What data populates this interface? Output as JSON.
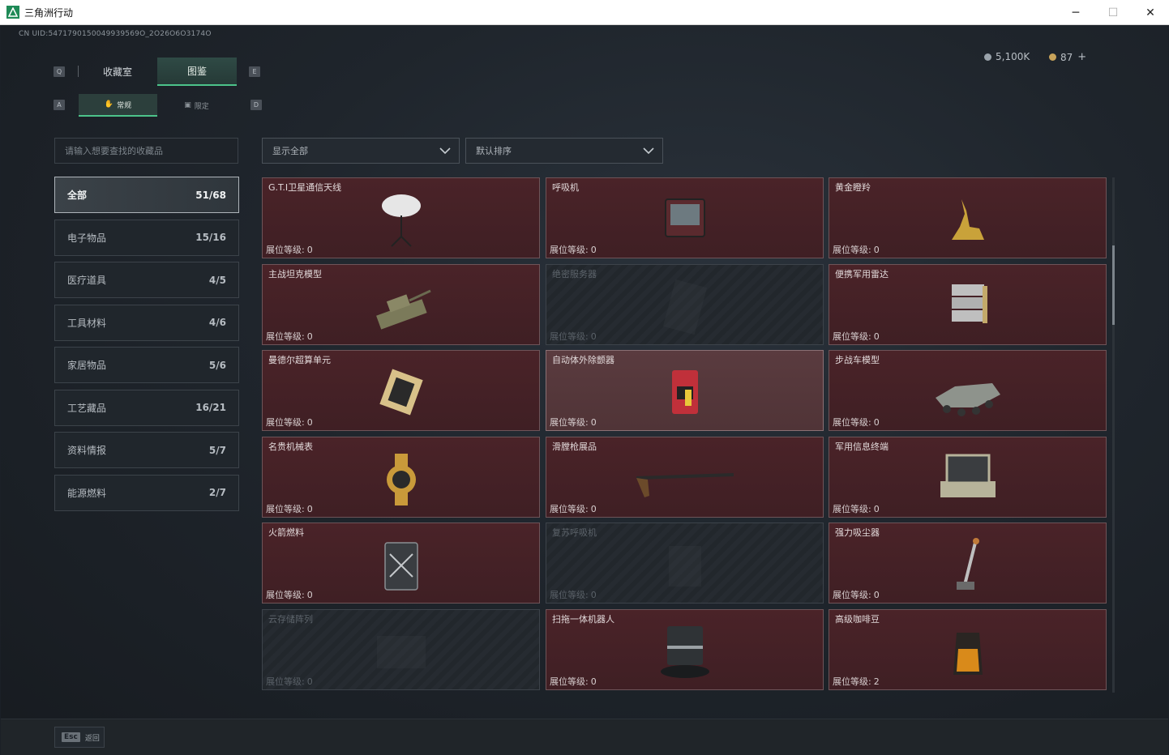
{
  "window": {
    "title": "三角洲行动",
    "minimize_icon": "minimize-icon",
    "maximize_icon": "maximize-icon",
    "close_icon": "close-icon"
  },
  "header": {
    "uid": "CN UID:5471790150049939569O_2O26O6O3174O",
    "currency": [
      {
        "value": "5,100K",
        "icon": "silver-coin-icon",
        "color": "#9aa3ab"
      },
      {
        "value": "87",
        "icon": "gold-coin-icon",
        "color": "#c8a35a",
        "plus": "+"
      }
    ]
  },
  "tabs": {
    "key_left": "Q",
    "key_right": "E",
    "items": [
      {
        "label": "收藏室",
        "active": false
      },
      {
        "label": "图鉴",
        "active": true
      }
    ]
  },
  "subtabs": {
    "key_left": "A",
    "key_right": "D",
    "items": [
      {
        "label": "常规",
        "icon": "hand-icon",
        "active": true
      },
      {
        "label": "限定",
        "icon": "image-icon",
        "active": false
      }
    ]
  },
  "search": {
    "placeholder": "请输入想要查找的收藏品"
  },
  "filters": {
    "display": "显示全部",
    "sort": "默认排序"
  },
  "categories": [
    {
      "label": "全部",
      "count": "51/68",
      "active": true
    },
    {
      "label": "电子物品",
      "count": "15/16",
      "active": false
    },
    {
      "label": "医疗道具",
      "count": "4/5",
      "active": false
    },
    {
      "label": "工具材料",
      "count": "4/6",
      "active": false
    },
    {
      "label": "家居物品",
      "count": "5/6",
      "active": false
    },
    {
      "label": "工艺藏品",
      "count": "16/21",
      "active": false
    },
    {
      "label": "资料情报",
      "count": "5/7",
      "active": false
    },
    {
      "label": "能源燃料",
      "count": "2/7",
      "active": false
    }
  ],
  "level_label": "展位等级:",
  "items": [
    {
      "name": "G.T.I卫星通信天线",
      "level": "0",
      "locked": false,
      "icon": "satellite-dish-icon"
    },
    {
      "name": "呼吸机",
      "level": "0",
      "locked": false,
      "icon": "ventilator-icon"
    },
    {
      "name": "黄金瞪羚",
      "level": "0",
      "locked": false,
      "icon": "gold-gazelle-icon"
    },
    {
      "name": "主战坦克模型",
      "level": "0",
      "locked": false,
      "icon": "tank-model-icon"
    },
    {
      "name": "绝密服务器",
      "level": "0",
      "locked": true,
      "icon": "server-icon"
    },
    {
      "name": "便携军用雷达",
      "level": "0",
      "locked": false,
      "icon": "radar-icon"
    },
    {
      "name": "曼德尔超算单元",
      "level": "0",
      "locked": false,
      "icon": "compute-unit-icon"
    },
    {
      "name": "自动体外除颤器",
      "level": "0",
      "locked": false,
      "highlight": true,
      "icon": "defibrillator-icon"
    },
    {
      "name": "步战车模型",
      "level": "0",
      "locked": false,
      "icon": "ifv-model-icon"
    },
    {
      "name": "名贵机械表",
      "level": "0",
      "locked": false,
      "icon": "watch-icon"
    },
    {
      "name": "滑膛枪展品",
      "level": "0",
      "locked": false,
      "icon": "musket-icon"
    },
    {
      "name": "军用信息终端",
      "level": "0",
      "locked": false,
      "icon": "terminal-icon"
    },
    {
      "name": "火箭燃料",
      "level": "0",
      "locked": false,
      "icon": "fuel-can-icon"
    },
    {
      "name": "复苏呼吸机",
      "level": "0",
      "locked": true,
      "icon": "resuscitator-icon"
    },
    {
      "name": "强力吸尘器",
      "level": "0",
      "locked": false,
      "icon": "vacuum-icon"
    },
    {
      "name": "云存储阵列",
      "level": "0",
      "locked": true,
      "icon": "storage-array-icon"
    },
    {
      "name": "扫拖一体机器人",
      "level": "0",
      "locked": false,
      "icon": "robot-vacuum-icon"
    },
    {
      "name": "高级咖啡豆",
      "level": "2",
      "locked": false,
      "icon": "coffee-bag-icon"
    }
  ],
  "footer": {
    "key": "Esc",
    "label": "返回"
  }
}
